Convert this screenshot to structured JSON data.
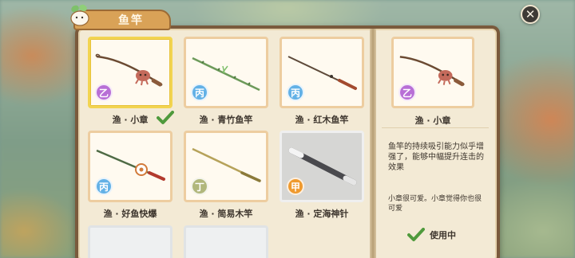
{
  "title": "鱼竿",
  "colors": {
    "accent": "#d9a257",
    "check": "#4f9a3c",
    "selected_border": "#f2d450"
  },
  "rods": [
    {
      "name": "渔 · 小章",
      "grade": "乙",
      "grade_color": "purple",
      "style": "octopus",
      "selected": true,
      "equipped": true
    },
    {
      "name": "渔 · 青竹鱼竿",
      "grade": "丙",
      "grade_color": "blue",
      "style": "bamboo"
    },
    {
      "name": "渔 · 红木鱼竿",
      "grade": "丙",
      "grade_color": "blue",
      "style": "redwood"
    },
    {
      "name": "渔 · 好鱼快爆",
      "grade": "丙",
      "grade_color": "blue",
      "style": "reel"
    },
    {
      "name": "渔 · 简易木竿",
      "grade": "丁",
      "grade_color": "olive",
      "style": "simple"
    },
    {
      "name": "渔 · 定海神针",
      "grade": "甲",
      "grade_color": "orange",
      "style": "staff"
    }
  ],
  "detail": {
    "name": "渔 · 小章",
    "grade": "乙",
    "description": "鱼竿的持续吸引能力似乎增强了，能够中幅提升连击的效果",
    "flavor": "小章很可爱。小章觉得你也很可爱",
    "status": "使用中"
  },
  "icons": {
    "close": "close-icon",
    "check": "check-icon",
    "mascot": "radish-mascot-icon"
  }
}
